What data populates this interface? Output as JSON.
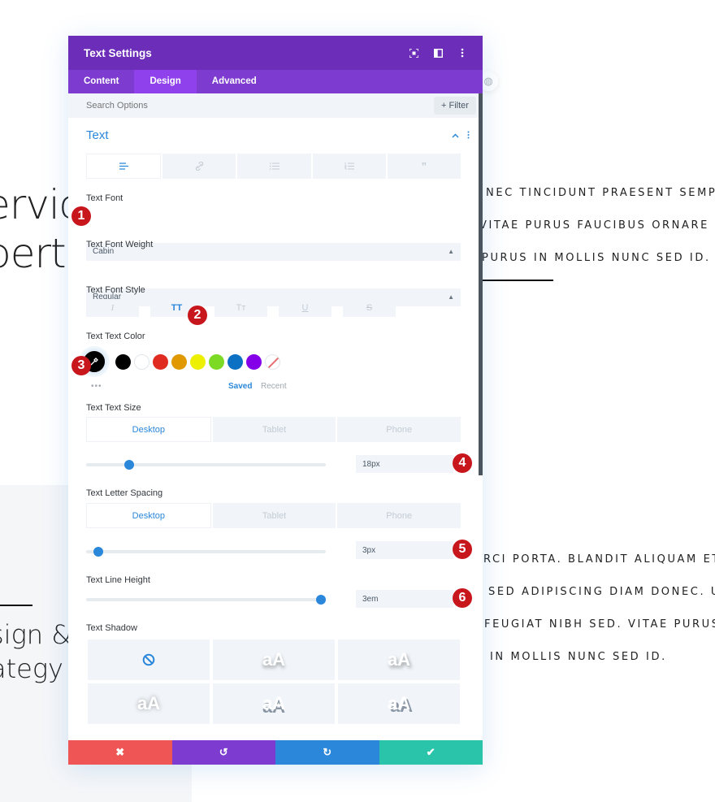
{
  "background": {
    "heading_top": [
      "ervic",
      "pert"
    ],
    "heading_bottom": [
      "sign &",
      "ategy"
    ],
    "paragraph_top": [
      "NEC TINCIDUNT PRAESENT SEMPER",
      "VITAE PURUS FAUCIBUS ORNARE SUS",
      "PURUS IN MOLLIS NUNC SED ID."
    ],
    "paragraph_bottom": [
      "RCI PORTA. BLANDIT ALIQUAM ETIAM",
      "SED ADIPISCING DIAM DONEC. URN",
      "FEUGIAT NIBH SED. VITAE PURUS FA",
      "IN MOLLIS NUNC SED ID."
    ]
  },
  "modal": {
    "title": "Text Settings",
    "header_icons": [
      "fullscreen-icon",
      "split-view-icon",
      "more-options-icon"
    ],
    "tabs": [
      {
        "label": "Content",
        "active": false
      },
      {
        "label": "Design",
        "active": true
      },
      {
        "label": "Advanced",
        "active": false
      }
    ],
    "search": {
      "placeholder": "Search Options",
      "value": ""
    },
    "filter_label": "+ Filter",
    "section": {
      "title": "Text",
      "alignment_tabs": [
        "text-paragraph-icon",
        "link-icon",
        "unordered-list-icon",
        "ordered-list-icon",
        "blockquote-icon"
      ],
      "text_font": {
        "label": "Text Font",
        "value": "Cabin"
      },
      "text_font_weight": {
        "label": "Text Font Weight",
        "value": "Regular"
      },
      "text_font_style": {
        "label": "Text Font Style",
        "options": [
          "I",
          "TT",
          "Tт",
          "U",
          "S"
        ],
        "active_index": 1
      },
      "text_color": {
        "label": "Text Text Color",
        "selected": "#000000",
        "swatches": [
          "#000000",
          "#ffffff",
          "#e02b20",
          "#e09900",
          "#edf000",
          "#7cda24",
          "#0c71c3",
          "#8300e9"
        ],
        "saved_label": "Saved",
        "recent_label": "Recent",
        "more_label": "•••"
      },
      "text_size": {
        "label": "Text Text Size",
        "devices": [
          "Desktop",
          "Tablet",
          "Phone"
        ],
        "active_device": "Desktop",
        "value": "18px",
        "slider_fraction": 0.18
      },
      "letter_spacing": {
        "label": "Text Letter Spacing",
        "devices": [
          "Desktop",
          "Tablet",
          "Phone"
        ],
        "active_device": "Desktop",
        "value": "3px",
        "slider_fraction": 0.05
      },
      "line_height": {
        "label": "Text Line Height",
        "value": "3em",
        "slider_fraction": 0.98
      },
      "text_shadow": {
        "label": "Text Shadow",
        "none_icon": "⦸",
        "preset_label": "aA"
      }
    },
    "footer": {
      "cancel_icon": "✖",
      "undo_icon": "↺",
      "redo_icon": "↻",
      "save_icon": "✔",
      "colors": {
        "cancel": "#ef5555",
        "undo": "#7e3bd0",
        "redo": "#2b87da",
        "save": "#29c4a9"
      }
    }
  },
  "annotations": [
    "1",
    "2",
    "3",
    "4",
    "5",
    "6"
  ]
}
